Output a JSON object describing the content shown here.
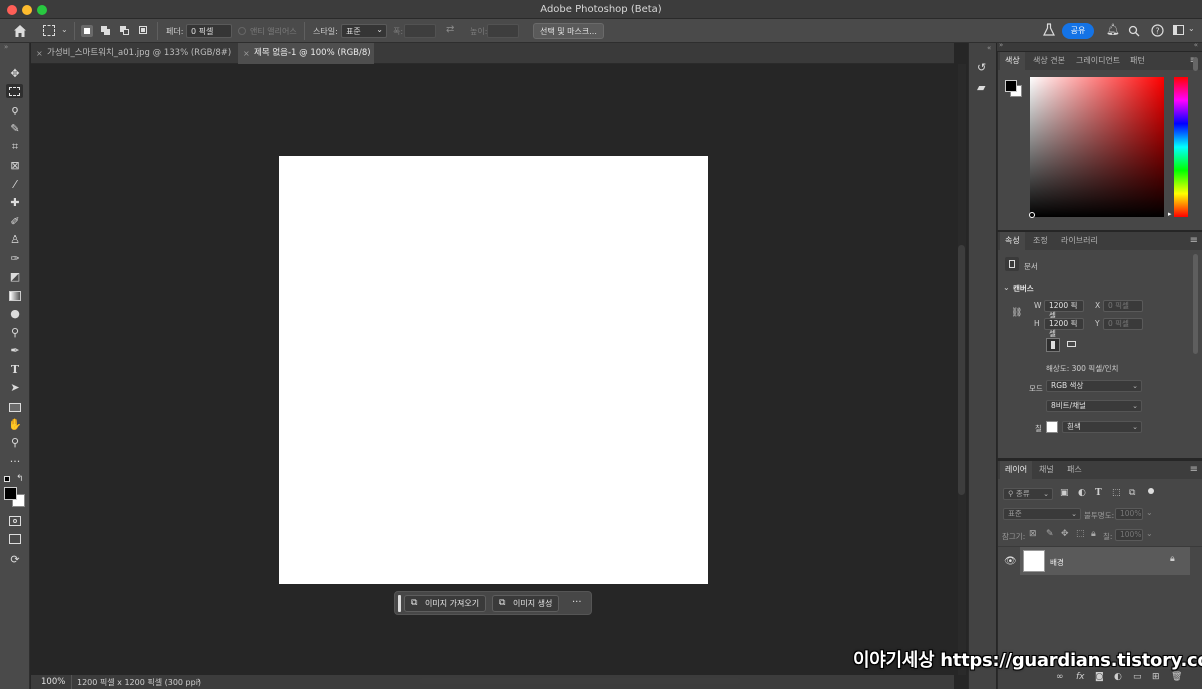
{
  "app": {
    "title": "Adobe Photoshop (Beta)"
  },
  "options_bar": {
    "feather_label": "페더:",
    "feather_value": "0 픽셀",
    "anti_alias_label": "앤티 앨리어스",
    "style_label": "스타일:",
    "style_value": "표준",
    "width_label": "폭:",
    "height_label": "높이:",
    "select_mask_button": "선택 및 마스크...",
    "share_button": "공유"
  },
  "doc_tabs": [
    {
      "label": "가성비_스마트워치_a01.jpg @ 133% (RGB/8#) *",
      "close": "×"
    },
    {
      "label": "제목 없음-1 @ 100% (RGB/8)",
      "close": "×"
    }
  ],
  "taskbar": {
    "import_image": "이미지 가져오기",
    "generate_image": "이미지 생성",
    "more": "···"
  },
  "status": {
    "zoom": "100%",
    "doc_info": "1200 픽셀 x 1200 픽셀 (300 ppi)",
    "arrow": "›"
  },
  "color_panel": {
    "tabs": [
      "색상",
      "색상 견본",
      "그레이디언트",
      "패턴"
    ]
  },
  "properties_panel": {
    "tabs": [
      "속성",
      "조정",
      "라이브러리"
    ],
    "document_label": "문서",
    "canvas_section": "캔버스",
    "w_label": "W",
    "w_value": "1200 픽셀",
    "h_label": "H",
    "h_value": "1200 픽셀",
    "x_label": "X",
    "x_value": "0 픽셀",
    "y_label": "Y",
    "y_value": "0 픽셀",
    "resolution": "해상도: 300 픽셀/인치",
    "mode_label": "모드",
    "mode_value": "RGB 색상",
    "bits_value": "8비트/채널",
    "fill_label": "칠",
    "fill_value": "흰색"
  },
  "layers_panel": {
    "tabs": [
      "레이어",
      "채널",
      "패스"
    ],
    "search_placeholder": "종류",
    "blend_mode": "표준",
    "opacity_label": "불투명도:",
    "opacity_value": "100%",
    "lock_label": "잠그기:",
    "fill_label": "칠:",
    "fill_value": "100%",
    "layers": [
      {
        "name": "배경",
        "visible": true,
        "locked": true
      }
    ]
  },
  "watermark": "이야기세상 https://guardians.tistory.com",
  "colors": {
    "accent": "#1473e6",
    "foreground": "#000000",
    "background": "#ffffff"
  }
}
